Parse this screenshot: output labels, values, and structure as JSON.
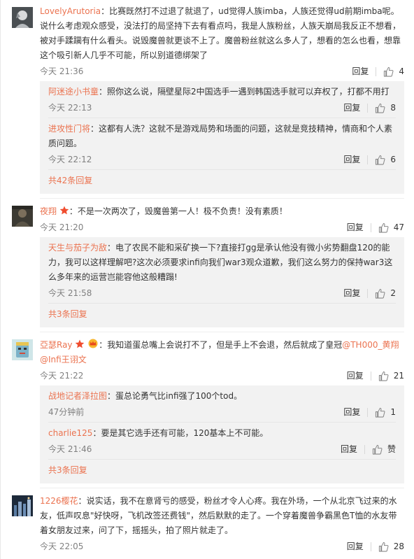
{
  "comments": [
    {
      "user": "LovelyArutoria",
      "sep": "：",
      "text": "比赛既然打不过退了就退了，ud觉得人族imba，人族还觉得ud前期imba呢。说什么考虑观众感受，没法打的局坚持下去有看点吗，我是人族粉丝，人族天崩局我反正不想看，被对手蹂躏有什么看头。说毁魔兽就更谈不上了。魔兽粉丝就这么多人了，想看的怎么也看，想靠这个吸引新人几乎不可能，所以别道德绑架了",
      "time": "今天 21:36",
      "reply": "回复",
      "likes": "4",
      "replies": [
        {
          "user": "阿迷途小书童",
          "sep": "：",
          "text": "照你这么说，隔壁星际2中国选手一遇到韩国选手就可以弃权了，打都不用打",
          "time": "今天 22:13",
          "reply": "回复",
          "likes": "8"
        },
        {
          "user": "进攻性门将",
          "sep": "：",
          "text": "这都有人洗？这就不是游戏局势和场面的问题，这就是竞技精神，情商和个人素质问题。",
          "time": "今天 22:12",
          "reply": "回复",
          "likes": "6"
        }
      ],
      "more": "共42条回复"
    },
    {
      "user": "夜翔",
      "sep": "：",
      "text": "不是一次两次了，毁魔兽第一人！极不负责！没有素质！",
      "time": "今天 21:20",
      "reply": "回复",
      "likes": "47",
      "replies": [
        {
          "user": "天生与茄子为敌",
          "sep": "：",
          "text": "电了农民不能和采矿换一下?直接打gg是承认他没有微小劣势翻盘120的能力，我可以这样理解吧?这次必须要求infi向我们war3观众道歉，我们这么努力的保持war3这么多年来的运营岂能容他这般糟蹋!",
          "time": "今天 21:58",
          "reply": "回复",
          "likes": "2"
        }
      ],
      "more": "共3条回复"
    },
    {
      "user": "亞瑟Ray",
      "sep": "：",
      "text_before": "我知道蛋总嘴上会说打不了，但是手上不会退，然后就成了皇冠",
      "mention1": "@TH000_黄翔",
      "mention2": "@Infi王诩文",
      "time": "今天 21:22",
      "reply": "回复",
      "likes": "21",
      "replies": [
        {
          "user": "战地记者泽拉图",
          "sep": "：",
          "text": "蛋总论勇气比infi强了100个tod。",
          "time": "47分钟前",
          "reply": "回复",
          "likes": "1"
        },
        {
          "user": "charlie125",
          "sep": "：",
          "text": "要是其它选手还有可能，120基本上不可能。",
          "time": "今天 21:46",
          "reply": "回复",
          "likes": "赞"
        }
      ],
      "more": "共3条回复"
    },
    {
      "user": "1226樱花",
      "sep": "：",
      "text": "说实话，我不在意肾亏的感受，粉丝才令人心疼。我在外场，一个从北京飞过来的水友，低声叹息\"好快呀，飞机改签还费钱\"，然后默默的走了。一个穿着魔兽争霸黑色T恤的水友带着女朋友过来，问了下，摇摇头，拍了照片就走了。",
      "time": "今天 22:05",
      "reply": "回复",
      "likes": "28"
    }
  ],
  "colors": {
    "accent": "#eb7350",
    "subBg": "#f2f2f2",
    "meta": "#808080"
  },
  "icons": {
    "like": "thumbs-up-icon",
    "vip": "vip-crown-icon",
    "star": "star-badge-icon"
  }
}
